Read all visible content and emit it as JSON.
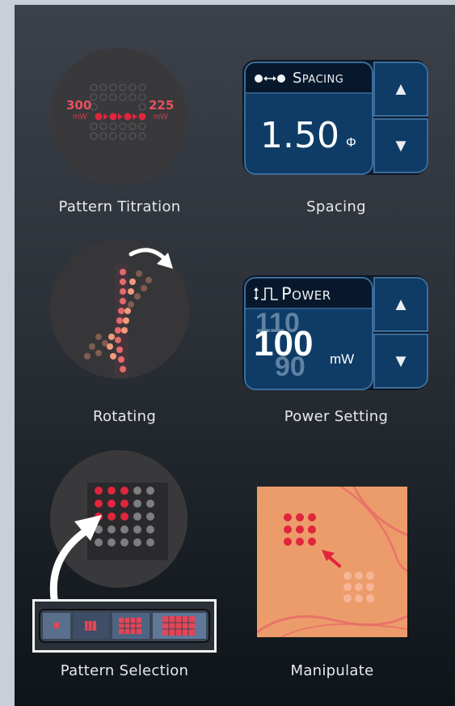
{
  "tiles": {
    "titration": {
      "caption": "Pattern Titration",
      "left_value": "300",
      "left_unit": "mW",
      "right_value": "225",
      "right_unit": "mW"
    },
    "spacing": {
      "caption": "Spacing",
      "header_icon": "spacing-dots-icon",
      "header_label": "Spacing",
      "value": "1.50",
      "unit": "Φ",
      "up_symbol": "▲",
      "down_symbol": "▼"
    },
    "rotating": {
      "caption": "Rotating"
    },
    "power": {
      "caption": "Power Setting",
      "header_icon": "pulse-icon",
      "header_label": "Power",
      "value_above": "110",
      "value": "100",
      "value_below": "90",
      "unit": "mW",
      "up_symbol": "▲",
      "down_symbol": "▼"
    },
    "selection": {
      "caption": "Pattern Selection"
    },
    "manipulate": {
      "caption": "Manipulate"
    }
  },
  "colors": {
    "panel_top": "#3c414a",
    "panel_bottom": "#0e1418",
    "control_blue": "#0e3c66",
    "spot_red": "#e0253c",
    "spot_salmon": "#f08a6e",
    "tissue": "#ec9c6a"
  }
}
